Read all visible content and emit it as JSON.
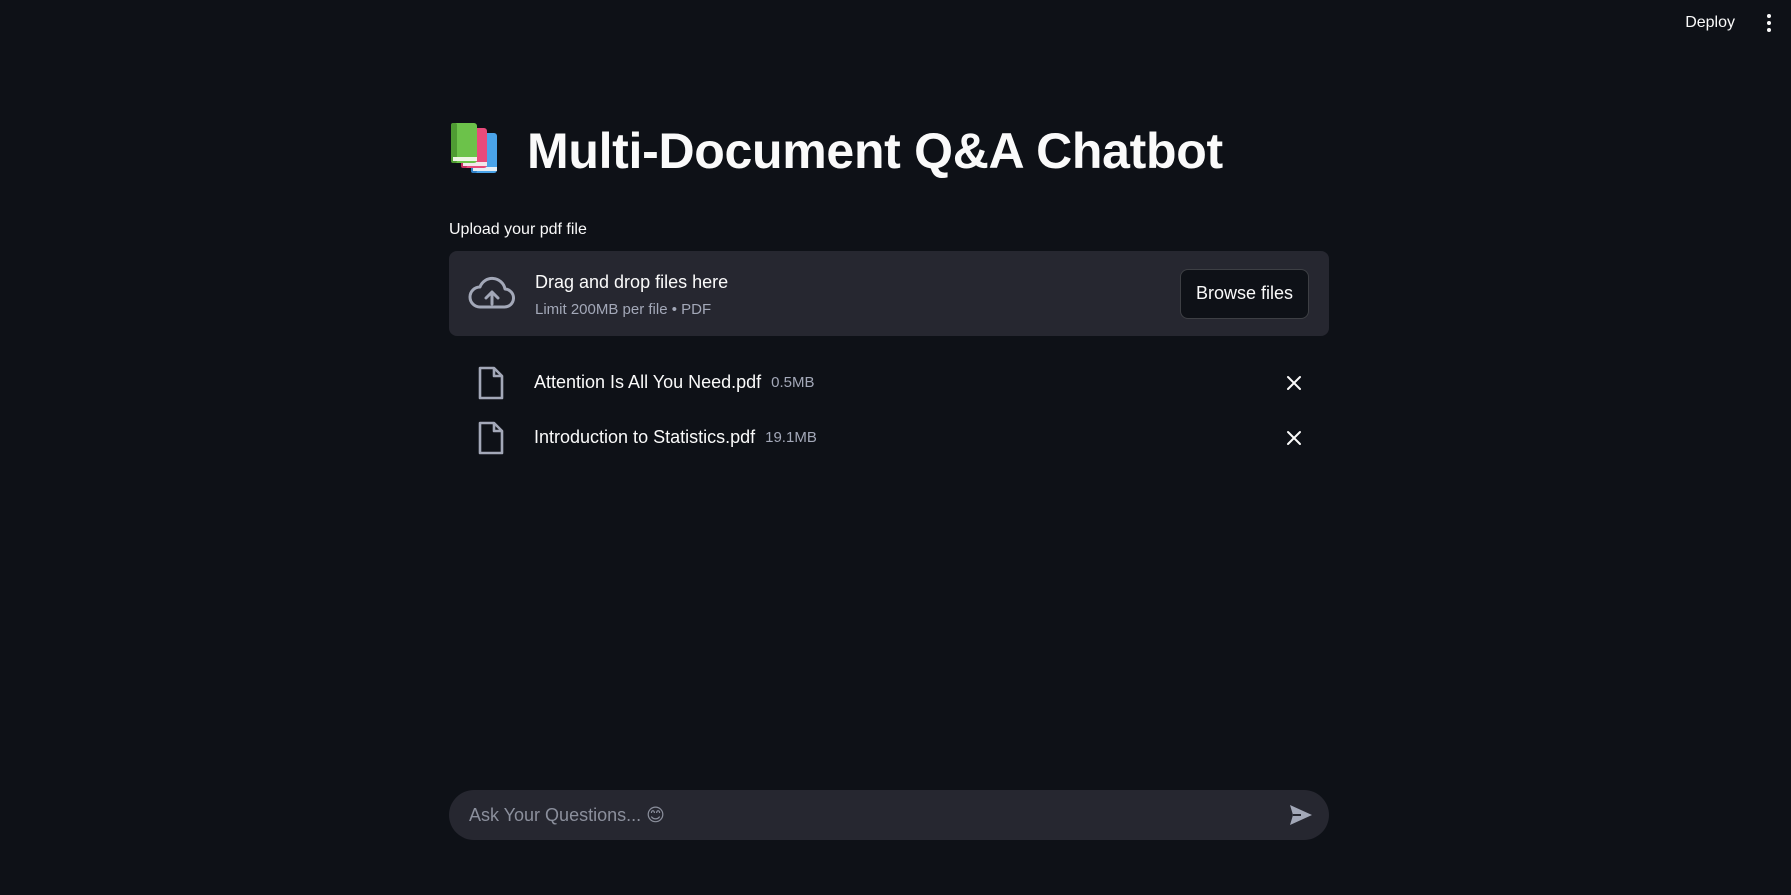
{
  "toolbar": {
    "deploy_label": "Deploy",
    "menu_icon": "kebab-menu-icon"
  },
  "header": {
    "icon": "books-icon",
    "title": "Multi-Document Q&A Chatbot"
  },
  "uploader": {
    "label": "Upload your pdf file",
    "dropzone_title": "Drag and drop files here",
    "dropzone_subtitle": "Limit 200MB per file • PDF",
    "browse_label": "Browse files",
    "icon": "cloud-upload-icon"
  },
  "files": [
    {
      "name": "Attention Is All You Need.pdf",
      "size": "0.5MB"
    },
    {
      "name": "Introduction to Statistics.pdf",
      "size": "19.1MB"
    }
  ],
  "chat": {
    "placeholder": "Ask Your Questions... 😊",
    "send_icon": "send-icon"
  },
  "colors": {
    "background": "#0e1117",
    "surface": "#262730",
    "text": "#fafafa",
    "muted": "#a3a8b8"
  }
}
